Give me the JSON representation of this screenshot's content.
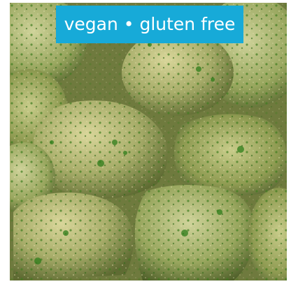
{
  "product_image": {
    "alt_subject": "breaded-green-bites-photo",
    "badge": {
      "label": "vegan • gluten free",
      "background_color": "#17aad8",
      "text_color": "#ffffff"
    }
  }
}
